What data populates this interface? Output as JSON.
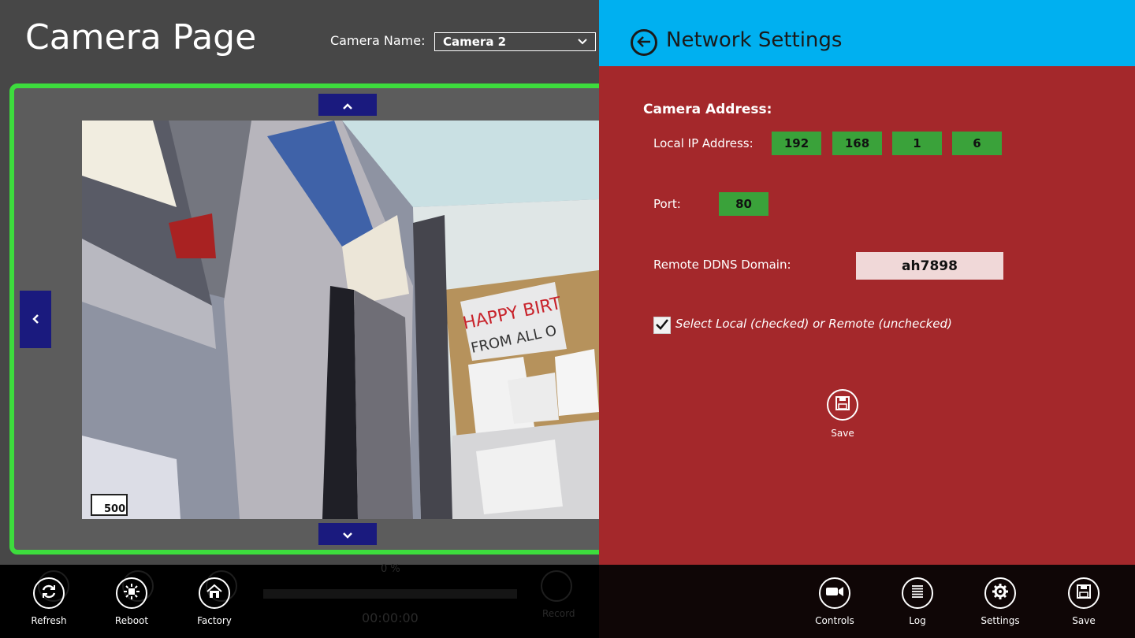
{
  "header": {
    "title": "Camera Page",
    "camera_name_label": "Camera Name:",
    "camera_selected": "Camera 2"
  },
  "camera_controls": {
    "up_icon": "chevron-up-icon",
    "down_icon": "chevron-down-icon",
    "left_icon": "chevron-left-icon"
  },
  "panel": {
    "title": "Network Settings",
    "back_icon": "back-arrow-icon",
    "section_title": "Camera Address:",
    "local_ip_label": "Local IP Address:",
    "ip": [
      "192",
      "168",
      "1",
      "6"
    ],
    "port_label": "Port:",
    "port": "80",
    "ddns_label": "Remote DDNS Domain:",
    "ddns": "ah7898",
    "checkbox_label": "Select Local (checked) or Remote (unchecked)",
    "checkbox_checked": true,
    "save_label": "Save"
  },
  "recording": {
    "progress": "0 %",
    "time": "00:00:00",
    "record_label": "Record",
    "progress_value": 0
  },
  "appbar": {
    "left": [
      {
        "label": "Refresh",
        "icon": "refresh-icon"
      },
      {
        "label": "Reboot",
        "icon": "reboot-icon"
      },
      {
        "label": "Factory",
        "icon": "home-icon"
      }
    ],
    "right": [
      {
        "label": "Controls",
        "icon": "video-camera-icon"
      },
      {
        "label": "Log",
        "icon": "list-icon"
      },
      {
        "label": "Settings",
        "icon": "gear-icon"
      },
      {
        "label": "Save",
        "icon": "floppy-disk-icon"
      }
    ]
  },
  "colors": {
    "accent_header": "#00b0f0",
    "panel_bg": "#a4282b",
    "field_green": "#3aa23a",
    "frame_green": "#3ddc3d",
    "nav_blue": "#1a1a7e"
  }
}
